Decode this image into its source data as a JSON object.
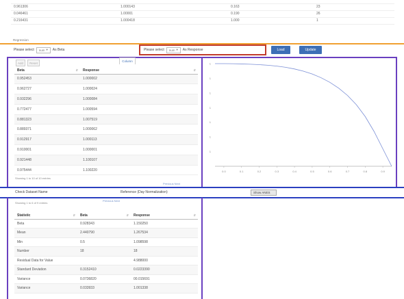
{
  "top_table": {
    "rows": [
      [
        "",
        "",
        "",
        ""
      ],
      [
        "0.961306",
        "1.000143",
        "0.163",
        "23"
      ],
      [
        "0.046461",
        "1.00001",
        "0.190",
        "26"
      ],
      [
        "0.216431",
        "1.000418",
        "1.000",
        "1"
      ]
    ]
  },
  "regression": {
    "section_label": "Regression",
    "x_select": {
      "label": "Please select",
      "hint": "num",
      "value": "As Beta"
    },
    "y_select": {
      "label": "Please select",
      "hint": "num",
      "value": "As Response"
    },
    "buttons": {
      "load": "Load",
      "update": "Update"
    }
  },
  "data_panel": {
    "buttons": {
      "a": "Add",
      "b": "Reset"
    },
    "tab_label": "Column",
    "columns": [
      "Beta",
      "Response"
    ],
    "rows": [
      [
        "0.952453",
        "1.000002"
      ],
      [
        "0.962727",
        "1.000024"
      ],
      [
        "0.932296",
        "1.000084"
      ],
      [
        "0.772477",
        "1.000594"
      ],
      [
        "0.881323",
        "1.007519"
      ],
      [
        "0.889371",
        "1.000062"
      ],
      [
        "0.912917",
        "1.000113"
      ],
      [
        "0.910001",
        "1.000001"
      ],
      [
        "0.921448",
        "1.100107"
      ],
      [
        "0.975444",
        "1.100220"
      ]
    ],
    "footer_text": "Showing 1 to 10 of 10 entries",
    "pagination_text": "Previous Next"
  },
  "chart_data": {
    "type": "line",
    "title": "",
    "xlabel": "",
    "ylabel": "",
    "xlim": [
      0,
      1
    ],
    "ylim": [
      0,
      1
    ],
    "x_ticks": [
      "0.0",
      "0.1",
      "0.2",
      "0.3",
      "0.4",
      "0.5",
      "0.6",
      "0.7",
      "0.8",
      "0.9"
    ],
    "y_ticks": [
      "1",
      "1",
      "1",
      "1",
      "1",
      "1",
      "1"
    ],
    "series": [
      {
        "color": "#7b8fd6",
        "x": [
          0.0,
          0.05,
          0.1,
          0.15,
          0.2,
          0.25,
          0.3,
          0.35,
          0.4,
          0.45,
          0.5,
          0.55,
          0.6,
          0.65,
          0.7,
          0.75,
          0.8,
          0.85,
          0.9,
          0.95,
          1.0
        ],
        "y": [
          1.0,
          1.0,
          0.999,
          0.997,
          0.994,
          0.99,
          0.984,
          0.976,
          0.964,
          0.948,
          0.927,
          0.899,
          0.863,
          0.818,
          0.761,
          0.69,
          0.6,
          0.485,
          0.34,
          0.17,
          0.0
        ]
      }
    ]
  },
  "info_row": {
    "dataset_label": "Check Dataset Name",
    "reference_label": "Reference (Day Normalization)",
    "show_button": "Show ANES"
  },
  "summary_panel": {
    "header_text": "Showing 1 to 6 of 9 entries",
    "pagination_text": "Previous Next",
    "columns": [
      "Statistic",
      "Beta",
      "Response"
    ],
    "rows": [
      [
        "Beta",
        "0.928343",
        "1.150250"
      ],
      [
        "Mean",
        "2.440790",
        "1.267534"
      ],
      [
        "Min",
        "0.5",
        "1.098598"
      ],
      [
        "Number",
        "18",
        "18"
      ],
      [
        "Residual Data for Value",
        "",
        "4.988000"
      ],
      [
        "Standard Deviation",
        "0.3152410",
        "0.0223390"
      ],
      [
        "Variance",
        "0.0736820",
        "00.015691"
      ],
      [
        "Variance",
        "0.033933",
        "1.001338"
      ]
    ]
  },
  "colors": {
    "orange": "#f0a030",
    "red": "#c0392b",
    "purple": "#6a3fc0",
    "blue": "#2a3fc0",
    "button_blue": "#3d6fb6",
    "curve": "#7b8fd6"
  }
}
